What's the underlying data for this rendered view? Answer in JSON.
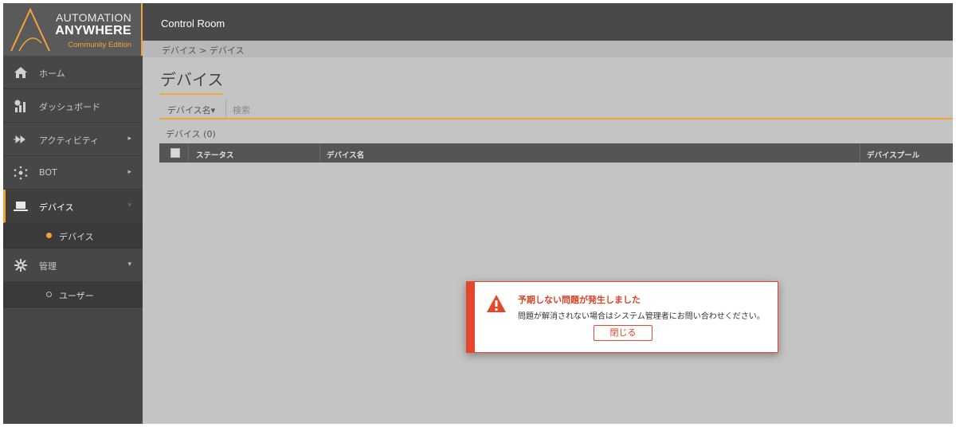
{
  "logo": {
    "line1": "AUTOMATION",
    "line2": "ANYWHERE",
    "line3": "Community Edition"
  },
  "sidebar": {
    "items": [
      {
        "label": "ホーム",
        "icon": "home-icon"
      },
      {
        "label": "ダッシュボード",
        "icon": "dashboard-icon"
      },
      {
        "label": "アクティビティ",
        "icon": "activity-icon",
        "arrow": "▸"
      },
      {
        "label": "BOT",
        "icon": "bot-icon",
        "arrow": "▸"
      },
      {
        "label": "デバイス",
        "icon": "laptop-icon",
        "arrow": "▾",
        "active": true
      },
      {
        "label": "管理",
        "icon": "gear-icon",
        "arrow": "▾"
      }
    ],
    "sub_devices": {
      "label": "デバイス"
    },
    "sub_admin": {
      "label": "ユーザー"
    }
  },
  "header": {
    "title": "Control Room"
  },
  "breadcrumb": {
    "text": "デバイス > デバイス"
  },
  "page": {
    "title": "デバイス",
    "filter_field": "デバイス名▾",
    "search_placeholder": "検索",
    "count": "デバイス (0)"
  },
  "table": {
    "columns": [
      "ステータス",
      "デバイス名",
      "デバイスプール"
    ]
  },
  "modal": {
    "title": "予期しない問題が発生しました",
    "message": "問題が解消されない場合はシステム管理者にお問い合わせください。",
    "button": "閉じる"
  },
  "colors": {
    "accent": "#f2a33a",
    "error": "#e3482c",
    "sidebar": "#474747",
    "header": "#494949"
  }
}
